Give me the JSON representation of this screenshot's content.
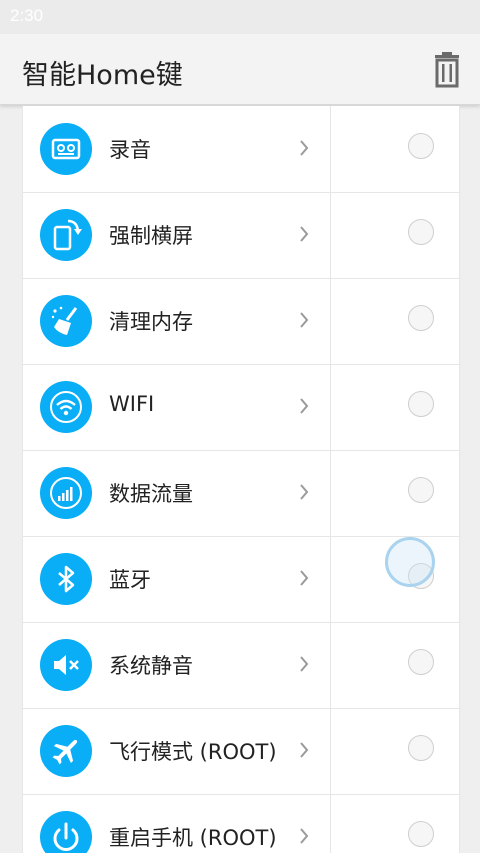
{
  "status_bar": {
    "time": "2:30"
  },
  "app_bar": {
    "title": "智能Home键"
  },
  "items": [
    {
      "label": "录音",
      "icon": "recorder-icon"
    },
    {
      "label": "强制横屏",
      "icon": "rotate-screen-icon"
    },
    {
      "label": "清理内存",
      "icon": "broom-clean-icon"
    },
    {
      "label": "WIFI",
      "icon": "wifi-icon"
    },
    {
      "label": "数据流量",
      "icon": "signal-bars-icon"
    },
    {
      "label": "蓝牙",
      "icon": "bluetooth-icon"
    },
    {
      "label": "系统静音",
      "icon": "mute-speaker-icon"
    },
    {
      "label": "飞行模式 (ROOT)",
      "icon": "airplane-icon"
    },
    {
      "label": "重启手机 (ROOT)",
      "icon": "power-icon"
    }
  ],
  "colors": {
    "accent": "#0aaef6",
    "background": "#efefef"
  }
}
